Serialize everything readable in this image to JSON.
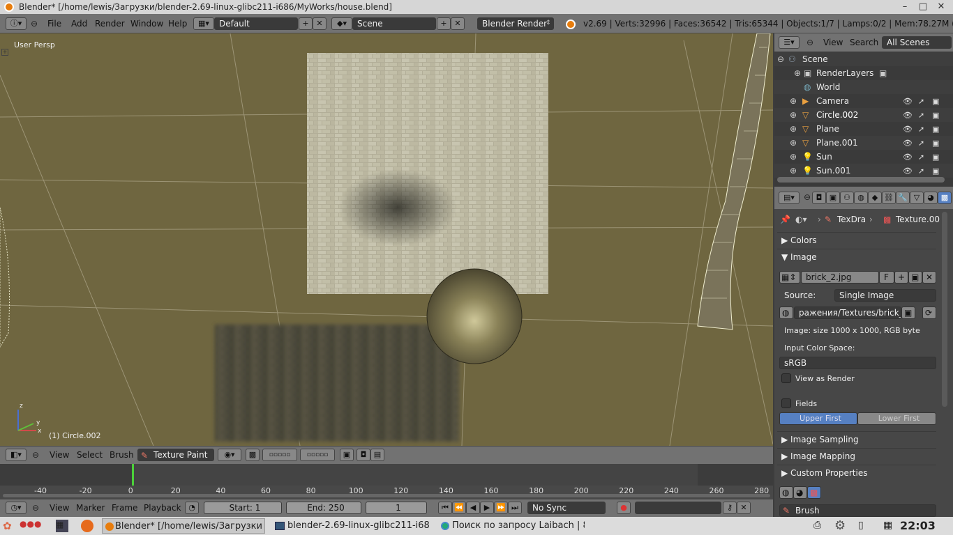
{
  "window": {
    "title": "Blender* [/home/lewis/Загрузки/blender-2.69-linux-glibc211-i686/MyWorks/house.blend]",
    "minimize": "–",
    "maximize": "□",
    "close": "✕"
  },
  "info_header": {
    "menus": [
      "File",
      "Add",
      "Render",
      "Window",
      "Help"
    ],
    "layout": "Default",
    "scene": "Scene",
    "engine": "Blender Render",
    "stats": "v2.69 | Verts:32996 | Faces:36542 | Tris:65344 | Objects:1/7 | Lamps:0/2 | Mem:78.27M (58.83M) | Circ"
  },
  "viewport": {
    "view_label": "User Persp",
    "object_label": "(1) Circle.002",
    "axis_x": "x",
    "axis_y": "y",
    "axis_z": "z"
  },
  "view3d_header": {
    "menus": [
      "View",
      "Select",
      "Brush"
    ],
    "mode": "Texture Paint"
  },
  "timeline": {
    "ticks": [
      "-40",
      "-20",
      "0",
      "20",
      "40",
      "60",
      "80",
      "100",
      "120",
      "140",
      "160",
      "180",
      "200",
      "220",
      "240",
      "260",
      "280"
    ],
    "current_frame_marker": 0,
    "menus": [
      "View",
      "Marker",
      "Frame",
      "Playback"
    ],
    "start": "Start: 1",
    "end": "End: 250",
    "frame": "1",
    "sync": "No Sync"
  },
  "outliner": {
    "menus": [
      "View",
      "Search"
    ],
    "filter": "All Scenes",
    "items": [
      {
        "label": "Scene",
        "icon": "scene-icon"
      },
      {
        "label": "RenderLayers",
        "icon": "renderlayers-icon"
      },
      {
        "label": "World",
        "icon": "world-icon"
      },
      {
        "label": "Camera",
        "icon": "camera-icon"
      },
      {
        "label": "Circle.002",
        "icon": "mesh-icon"
      },
      {
        "label": "Plane",
        "icon": "mesh-icon"
      },
      {
        "label": "Plane.001",
        "icon": "mesh-icon"
      },
      {
        "label": "Sun",
        "icon": "lamp-icon"
      },
      {
        "label": "Sun.001",
        "icon": "lamp-icon"
      }
    ]
  },
  "properties": {
    "breadcrumb_brush": "TexDra",
    "breadcrumb_texture": "Texture.00",
    "sections": {
      "colors": "Colors",
      "image": "Image",
      "image_sampling": "Image Sampling",
      "image_mapping": "Image Mapping",
      "custom_properties": "Custom Properties"
    },
    "image_name": "brick_2.jpg",
    "fake_user": "F",
    "source_label": "Source:",
    "source_value": "Single Image",
    "filepath": "ражения/Textures/brick_2.jpg",
    "image_info": "Image: size 1000 x 1000, RGB byte",
    "color_space_label": "Input Color Space:",
    "color_space": "sRGB",
    "view_as_render": "View as Render",
    "fields": "Fields",
    "upper_first": "Upper First",
    "lower_first": "Lower First",
    "brush_label": "Brush"
  },
  "taskbar": {
    "tasks": [
      "Blender* [/home/lewis/Загрузки",
      "blender-2.69-linux-glibc211-i68",
      "Поиск по запросу Laibach | 8"
    ],
    "clock": "22:03"
  },
  "colors": {
    "viewport_bg": "#6f6640",
    "header_gray": "#727272",
    "upper_first_active": "#5680c2"
  }
}
